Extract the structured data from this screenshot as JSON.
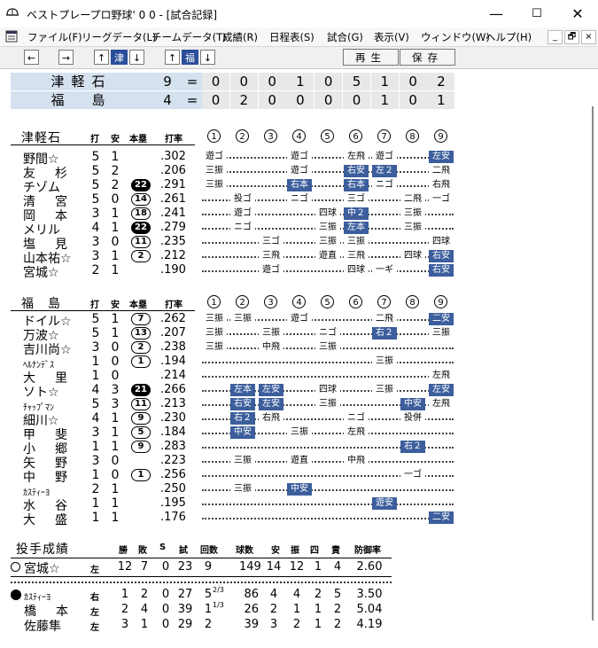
{
  "window": {
    "title": "ベストプレープロ野球' 0 0 - [試合記録]",
    "minimize": "—",
    "maximize": "☐",
    "close": "✕"
  },
  "menu": [
    "ファイル(F)",
    "リーグデータ(L)",
    "チームデータ(T)",
    "成績(R)",
    "日程表(S)",
    "試合(G)",
    "表示(V)",
    "ウィンドウ(W)",
    "ヘルプ(H)"
  ],
  "mdi": {
    "min": "_",
    "restore": "🗗",
    "close": "×"
  },
  "toolbar": {
    "left": "←",
    "right": "→",
    "up": "↑",
    "down": "↓",
    "team1": "津",
    "team2": "福",
    "play": "再生",
    "save": "保存"
  },
  "scoreboard": [
    {
      "team": "津軽石",
      "total": "9",
      "eq": "=",
      "innings": [
        "0",
        "0",
        "0",
        "1",
        "0",
        "5",
        "1",
        "0",
        "2"
      ]
    },
    {
      "team": "福　島",
      "total": "4",
      "eq": "=",
      "innings": [
        "0",
        "2",
        "0",
        "0",
        "0",
        "0",
        "1",
        "0",
        "1"
      ]
    }
  ],
  "batting_headers": {
    "ab": "打",
    "h": "安",
    "hr": "本塁",
    "avg": "打率",
    "innings": [
      "1",
      "2",
      "3",
      "4",
      "5",
      "6",
      "7",
      "8",
      "9"
    ]
  },
  "team1": {
    "name": "津軽石",
    "players": [
      {
        "name": "野間☆",
        "ab": "5",
        "h": "1",
        "hr": "",
        "avg": ".302",
        "res": [
          "遊ゴ",
          "",
          "",
          "遊ゴ",
          "",
          "左飛",
          "遊ゴ",
          "",
          "左安"
        ],
        "hits": [
          8
        ]
      },
      {
        "name": "友　杉",
        "ab": "5",
        "h": "2",
        "hr": "",
        "avg": ".206",
        "res": [
          "三振",
          "",
          "",
          "遊ゴ",
          "",
          "右安",
          "左２",
          "",
          "二飛"
        ],
        "hits": [
          5,
          6
        ]
      },
      {
        "name": "チゾム",
        "ab": "5",
        "h": "2",
        "hr": "22",
        "hrfill": true,
        "avg": ".291",
        "res": [
          "三振",
          "",
          "",
          "右本",
          "",
          "右本",
          "ニゴ",
          "",
          "右飛"
        ],
        "hits": [
          3,
          5
        ]
      },
      {
        "name": "清　宮",
        "ab": "5",
        "h": "0",
        "hr": "14",
        "avg": ".261",
        "res": [
          "",
          "投ゴ",
          "",
          "ニゴ",
          "",
          "三ゴ",
          "",
          "二飛",
          "一ゴ"
        ],
        "hits": []
      },
      {
        "name": "岡　本",
        "ab": "3",
        "h": "1",
        "hr": "18",
        "avg": ".241",
        "res": [
          "",
          "遊ゴ",
          "",
          "",
          "四球",
          "中２",
          "",
          "三振",
          ""
        ],
        "hits": [
          5
        ]
      },
      {
        "name": "メリル",
        "ab": "4",
        "h": "1",
        "hr": "22",
        "hrfill": true,
        "avg": ".279",
        "res": [
          "",
          "ニゴ",
          "",
          "",
          "三振",
          "左本",
          "",
          "三振",
          ""
        ],
        "hits": [
          5
        ]
      },
      {
        "name": "塩　見",
        "ab": "3",
        "h": "0",
        "hr": "11",
        "avg": ".235",
        "res": [
          "",
          "",
          "三ゴ",
          "",
          "三振",
          "三振",
          "",
          "",
          "四球"
        ],
        "hits": []
      },
      {
        "name": "山本祐☆",
        "ab": "3",
        "h": "1",
        "hr": "2",
        "avg": ".212",
        "res": [
          "",
          "",
          "三飛",
          "",
          "遊直",
          "三飛",
          "",
          "四球",
          "右安"
        ],
        "hits": [
          8
        ]
      },
      {
        "name": "宮城☆",
        "ab": "2",
        "h": "1",
        "hr": "",
        "avg": ".190",
        "res": [
          "",
          "",
          "遊ゴ",
          "",
          "",
          "四球",
          "一ギ",
          "",
          "右安"
        ],
        "hits": [
          8
        ]
      }
    ]
  },
  "team2": {
    "name": "福　島",
    "players": [
      {
        "name": "ドイル☆",
        "ab": "5",
        "h": "1",
        "hr": "7",
        "avg": ".262",
        "res": [
          "三振",
          "三振",
          "",
          "遊ゴ",
          "",
          "",
          "二飛",
          "",
          "二安"
        ],
        "hits": [
          8
        ]
      },
      {
        "name": "万波☆",
        "ab": "5",
        "h": "1",
        "hr": "13",
        "avg": ".207",
        "res": [
          "三振",
          "",
          "三振",
          "",
          "ニゴ",
          "",
          "右２",
          "",
          "三振"
        ],
        "hits": [
          6
        ]
      },
      {
        "name": "吉川尚☆",
        "ab": "3",
        "h": "0",
        "hr": "2",
        "avg": ".238",
        "res": [
          "三振",
          "",
          "中飛",
          "",
          "三振",
          "",
          "",
          "",
          ""
        ],
        "hits": []
      },
      {
        "name": "ﾍﾙﾅﾝﾃﾞｽ",
        "ab": "1",
        "h": "0",
        "hr": "1",
        "avg": ".194",
        "res": [
          "",
          "",
          "",
          "",
          "",
          "",
          "三振",
          "",
          ""
        ],
        "hits": []
      },
      {
        "name": "大　里",
        "ab": "1",
        "h": "0",
        "hr": "",
        "avg": ".214",
        "res": [
          "",
          "",
          "",
          "",
          "",
          "",
          "",
          "",
          "左飛"
        ],
        "hits": []
      },
      {
        "name": "ソト☆",
        "ab": "4",
        "h": "3",
        "hr": "21",
        "hrfill": true,
        "avg": ".266",
        "res": [
          "",
          "左本",
          "左安",
          "",
          "四球",
          "",
          "三振",
          "",
          "左安"
        ],
        "hits": [
          1,
          2,
          8
        ]
      },
      {
        "name": "ﾁｬｯﾌﾟﾏﾝ",
        "ab": "5",
        "h": "3",
        "hr": "11",
        "avg": ".213",
        "res": [
          "",
          "右安",
          "左安",
          "",
          "三振",
          "",
          "",
          "中安",
          "左飛"
        ],
        "hits": [
          1,
          2,
          7
        ]
      },
      {
        "name": "細川☆",
        "ab": "4",
        "h": "1",
        "hr": "9",
        "avg": ".230",
        "res": [
          "",
          "右２",
          "右飛",
          "",
          "",
          "ニゴ",
          "",
          "投併",
          ""
        ],
        "hits": [
          1
        ]
      },
      {
        "name": "甲　斐",
        "ab": "3",
        "h": "1",
        "hr": "5",
        "avg": ".184",
        "res": [
          "",
          "中安",
          "",
          "三振",
          "",
          "左飛",
          "",
          "",
          ""
        ],
        "hits": [
          1
        ]
      },
      {
        "name": "小　郷",
        "ab": "1",
        "h": "1",
        "hr": "9",
        "avg": ".283",
        "res": [
          "",
          "",
          "",
          "",
          "",
          "",
          "",
          "右２",
          ""
        ],
        "hits": [
          7
        ]
      },
      {
        "name": "矢　野",
        "ab": "3",
        "h": "0",
        "hr": "",
        "avg": ".223",
        "res": [
          "",
          "三振",
          "",
          "遊直",
          "",
          "中飛",
          "",
          "",
          ""
        ],
        "hits": []
      },
      {
        "name": "中　野",
        "ab": "1",
        "h": "0",
        "hr": "1",
        "avg": ".256",
        "res": [
          "",
          "",
          "",
          "",
          "",
          "",
          "",
          "一ゴ",
          ""
        ],
        "hits": []
      },
      {
        "name": "ｶｽﾃｨｰﾖ",
        "ab": "2",
        "h": "1",
        "hr": "",
        "avg": ".250",
        "res": [
          "",
          "三振",
          "",
          "中安",
          "",
          "",
          "",
          "",
          ""
        ],
        "hits": [
          3
        ]
      },
      {
        "name": "水　谷",
        "ab": "1",
        "h": "1",
        "hr": "",
        "avg": ".195",
        "res": [
          "",
          "",
          "",
          "",
          "",
          "",
          "遊安",
          "",
          ""
        ],
        "hits": [
          6
        ]
      },
      {
        "name": "大　盛",
        "ab": "1",
        "h": "1",
        "hr": "",
        "avg": ".176",
        "res": [
          "",
          "",
          "",
          "",
          "",
          "",
          "",
          "",
          "二安"
        ],
        "hits": [
          8
        ]
      }
    ]
  },
  "pitching": {
    "title": "投手成績",
    "headers": [
      "勝",
      "敗",
      "S",
      "試",
      "回数",
      "球数",
      "安",
      "振",
      "四",
      "責",
      "防御率"
    ],
    "winner": {
      "name": "宮城☆",
      "hand": "左",
      "w": "12",
      "l": "7",
      "s": "0",
      "g": "23",
      "ip": "9",
      "ipfrac": "",
      "pitches": "149",
      "h": "14",
      "so": "12",
      "bb": "1",
      "er": "4",
      "era": "2.60"
    },
    "losers": [
      {
        "name": "ｶｽﾃｨｰﾖ",
        "hand": "右",
        "w": "1",
        "l": "2",
        "s": "0",
        "g": "27",
        "ip": "5",
        "ipfrac": "2/3",
        "pitches": "86",
        "h": "4",
        "so": "4",
        "bb": "2",
        "er": "5",
        "era": "3.50",
        "mark": true
      },
      {
        "name": "橋　本",
        "hand": "左",
        "w": "2",
        "l": "4",
        "s": "0",
        "g": "39",
        "ip": "1",
        "ipfrac": "1/3",
        "pitches": "26",
        "h": "2",
        "so": "1",
        "bb": "1",
        "er": "2",
        "era": "5.04"
      },
      {
        "name": "佐藤隼",
        "hand": "左",
        "w": "3",
        "l": "1",
        "s": "0",
        "g": "29",
        "ip": "2",
        "ipfrac": "",
        "pitches": "39",
        "h": "3",
        "so": "2",
        "bb": "1",
        "er": "2",
        "era": "4.19"
      }
    ]
  }
}
